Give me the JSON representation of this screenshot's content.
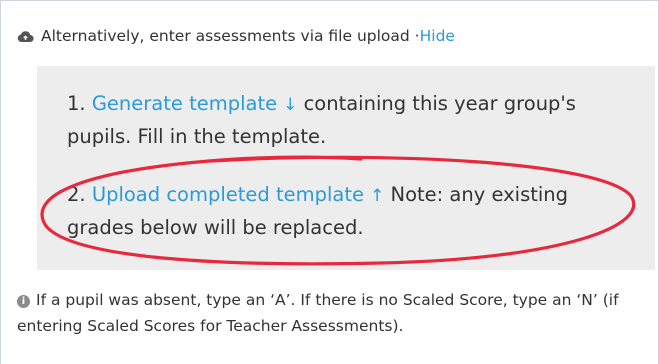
{
  "upload": {
    "intro_text": "Alternatively, enter assessments via file upload · ",
    "hide_link": "Hide",
    "icon": "cloud-upload-icon"
  },
  "steps": [
    {
      "number": "1.",
      "link_label": "Generate template",
      "arrow": "↓",
      "text_before_link": "",
      "text_after_link": " containing this year group's pupils. Fill in the template."
    },
    {
      "number": "2.",
      "link_label": "Upload completed template",
      "arrow": "↑",
      "text_after_link": " Note: any existing grades below will be replaced."
    }
  ],
  "info": {
    "icon": "info-icon",
    "text": "If a pupil was absent, type an ‘A’. If there is no Scaled Score, type an ‘N’ (if entering Scaled Scores for Teacher Assessments)."
  },
  "colors": {
    "link": "#2a9bd6",
    "annotation": "#e8283c",
    "panel_bg": "#ededed"
  }
}
